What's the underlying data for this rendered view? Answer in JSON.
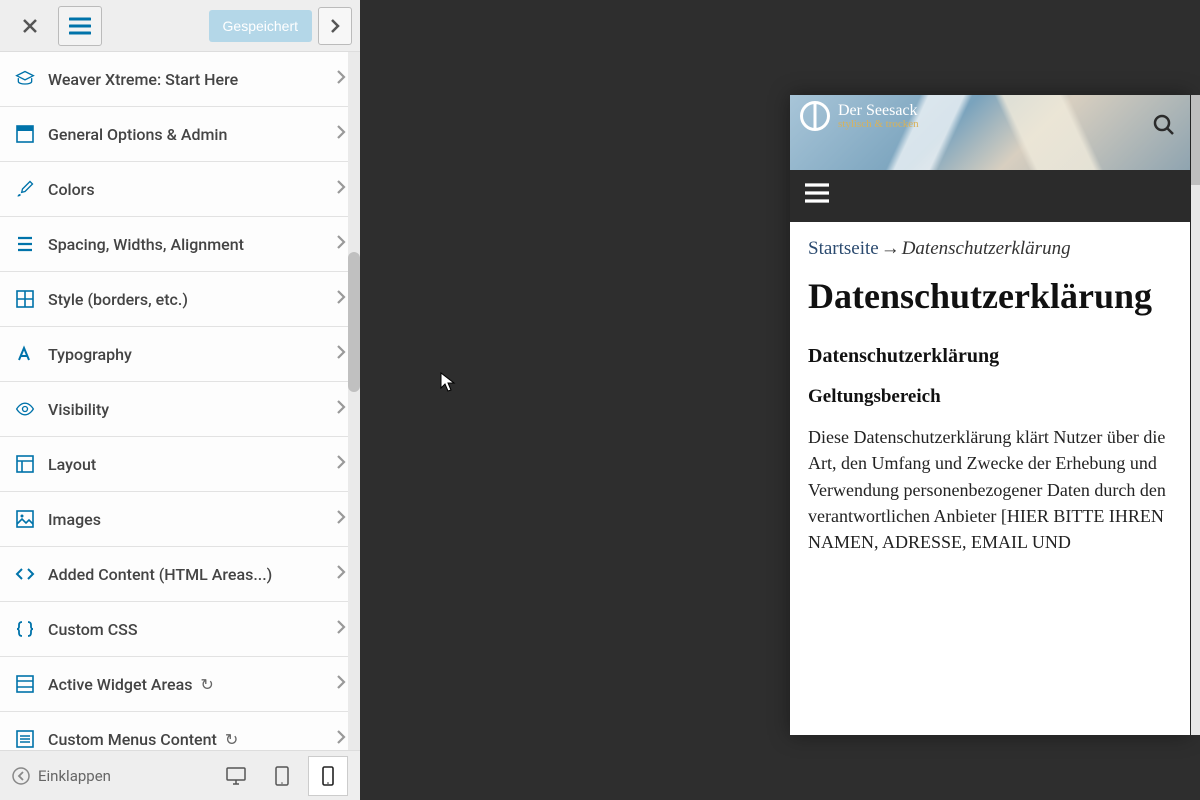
{
  "header": {
    "saved_label": "Gespeichert"
  },
  "menu_items": [
    {
      "icon": "graduation-cap",
      "label": "Weaver Xtreme: Start Here"
    },
    {
      "icon": "panel",
      "label": "General Options & Admin"
    },
    {
      "icon": "brush",
      "label": "Colors"
    },
    {
      "icon": "align",
      "label": "Spacing, Widths, Alignment"
    },
    {
      "icon": "grid",
      "label": "Style (borders, etc.)"
    },
    {
      "icon": "typography",
      "label": "Typography"
    },
    {
      "icon": "eye",
      "label": "Visibility"
    },
    {
      "icon": "layout",
      "label": "Layout"
    },
    {
      "icon": "image",
      "label": "Images"
    },
    {
      "icon": "code",
      "label": "Added Content (HTML Areas...)"
    },
    {
      "icon": "braces",
      "label": "Custom CSS"
    },
    {
      "icon": "widget",
      "label": "Active Widget Areas",
      "suffix": "↻"
    },
    {
      "icon": "menu",
      "label": "Custom Menus Content",
      "suffix": "↻"
    }
  ],
  "footer": {
    "collapse_label": "Einklappen"
  },
  "preview": {
    "site_title": "Der Seesack",
    "site_tagline": "stylisch & trocken",
    "breadcrumb_home": "Startseite",
    "breadcrumb_sep": "→",
    "breadcrumb_current": "Datenschutzerklärung",
    "title": "Datenschutzerklärung",
    "section_heading": "Datenschutzerklärung",
    "sub_heading": "Geltungsbereich",
    "body": "Diese Datenschutzerklärung klärt Nutzer über die Art, den Umfang und Zwecke der Erhebung und Verwendung personenbezogener Daten durch den verantwortlichen Anbieter [HIER BITTE IHREN NAMEN, ADRESSE, EMAIL UND"
  }
}
